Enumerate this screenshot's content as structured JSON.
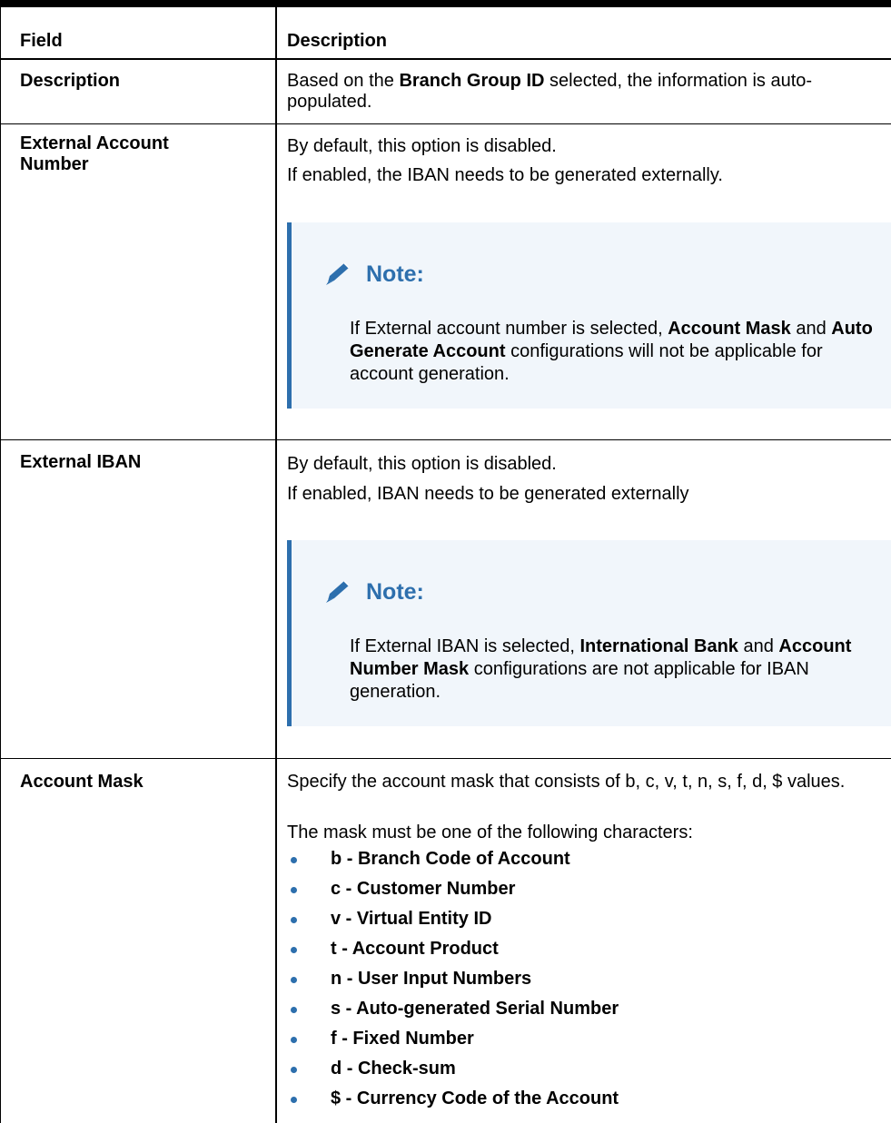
{
  "table": {
    "header": {
      "field": "Field",
      "description": "Description"
    },
    "rows": [
      {
        "field": "Description",
        "desc": {
          "pre": "Based on the ",
          "bold": "Branch Group ID",
          "post": " selected, the information is auto-populated."
        }
      },
      {
        "field": "External Account Number",
        "p1": "By default, this option is disabled.",
        "p2": "If enabled, the IBAN needs to be generated externally.",
        "note": {
          "title": "Note:",
          "t1": "If External account number is selected, ",
          "b1": "Account Mask",
          "t2": " and ",
          "b2": "Auto Generate Account",
          "t3": " configurations will not be applicable for account generation."
        }
      },
      {
        "field": "External IBAN",
        "p1": "By default, this option is disabled.",
        "p2": "If enabled, IBAN needs to be generated externally",
        "note": {
          "title": "Note:",
          "t1": "If External IBAN is selected, ",
          "b1": "International Bank",
          "t2": " and ",
          "b2": "Account Number Mask",
          "t3": " configurations are not applicable for IBAN generation."
        }
      },
      {
        "field": "Account Mask",
        "p1": "Specify the account mask that consists of b, c, v, t, n, s, f, d, $ values.",
        "p2": "The mask must be one of the following characters:",
        "items": [
          "b - Branch Code of Account",
          "c - Customer Number",
          "v - Virtual Entity ID",
          "t - Account Product",
          "n - User Input Numbers",
          "s - Auto-generated Serial Number",
          "f - Fixed Number",
          "d - Check-sum",
          "$ - Currency Code of the Account"
        ]
      }
    ]
  },
  "colors": {
    "accent": "#2d6fad",
    "note_bg": "#f1f6fb"
  },
  "icons": {
    "note": "pencil-icon"
  }
}
